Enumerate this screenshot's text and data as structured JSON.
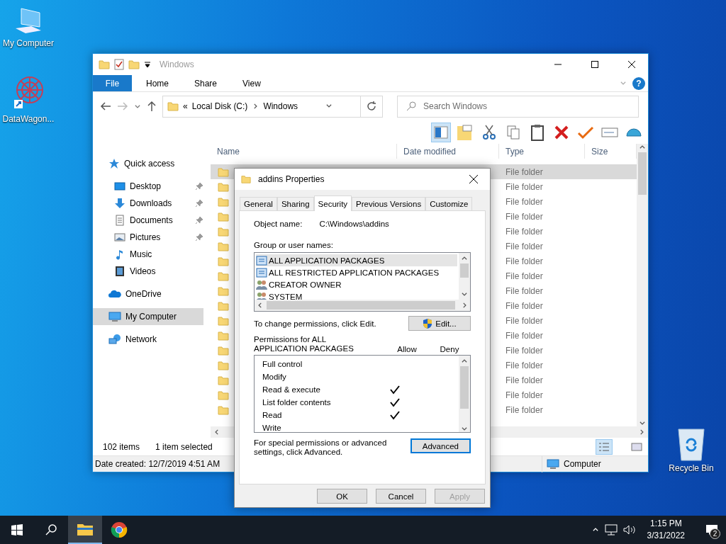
{
  "desktop_icons": [
    {
      "label": "My Computer",
      "kind": "computer"
    },
    {
      "label": "DataWagon...",
      "kind": "app"
    },
    {
      "label": "Recycle Bin",
      "kind": "recycle"
    }
  ],
  "explorer": {
    "title": "Windows",
    "file_tab": "File",
    "ribbon_tabs": [
      "Home",
      "Share",
      "View"
    ],
    "help": "?",
    "address": {
      "overflow": "«",
      "crumbs": [
        "Local Disk (C:)",
        "Windows"
      ]
    },
    "search": {
      "placeholder": "Search Windows"
    },
    "nav": [
      {
        "label": "Quick access",
        "kind": "star",
        "selected": false,
        "children": [
          {
            "label": "Desktop",
            "kind": "desktop",
            "pinned": true,
            "selected": false
          },
          {
            "label": "Downloads",
            "kind": "download",
            "pinned": true,
            "selected": false
          },
          {
            "label": "Documents",
            "kind": "document",
            "pinned": true,
            "selected": false
          },
          {
            "label": "Pictures",
            "kind": "pictures",
            "pinned": true,
            "selected": false
          },
          {
            "label": "Music",
            "kind": "music",
            "pinned": false,
            "selected": false
          },
          {
            "label": "Videos",
            "kind": "video",
            "pinned": false,
            "selected": false
          }
        ]
      },
      {
        "label": "OneDrive",
        "kind": "cloud",
        "selected": false
      },
      {
        "label": "My Computer",
        "kind": "computer",
        "selected": true
      },
      {
        "label": "Network",
        "kind": "network",
        "selected": false
      }
    ],
    "columns": [
      "Name",
      "Date modified",
      "Type",
      "Size"
    ],
    "rows": [
      {
        "type": "File folder",
        "selected": true
      },
      {
        "type": "File folder",
        "selected": false
      },
      {
        "type": "File folder",
        "selected": false
      },
      {
        "type": "File folder",
        "selected": false
      },
      {
        "type": "File folder",
        "selected": false
      },
      {
        "type": "File folder",
        "selected": false
      },
      {
        "type": "File folder",
        "selected": false
      },
      {
        "type": "File folder",
        "selected": false
      },
      {
        "type": "File folder",
        "selected": false
      },
      {
        "type": "File folder",
        "selected": false
      },
      {
        "type": "File folder",
        "selected": false
      },
      {
        "type": "File folder",
        "selected": false
      },
      {
        "type": "File folder",
        "selected": false
      },
      {
        "type": "File folder",
        "selected": false
      },
      {
        "type": "File folder",
        "selected": false
      },
      {
        "type": "File folder",
        "selected": false
      },
      {
        "type": "File folder",
        "selected": false
      }
    ],
    "status": {
      "count": "102 items",
      "selection": "1 item selected"
    },
    "details": {
      "created": "Date created: 12/7/2019 4:51 AM",
      "location": "Computer"
    }
  },
  "dialog": {
    "title": "addins Properties",
    "tabs": [
      {
        "label": "General",
        "selected": false
      },
      {
        "label": "Sharing",
        "selected": false
      },
      {
        "label": "Security",
        "selected": true
      },
      {
        "label": "Previous Versions",
        "selected": false
      },
      {
        "label": "Customize",
        "selected": false
      }
    ],
    "object_label": "Object name:",
    "object_value": "C:\\Windows\\addins",
    "groups_label": "Group or user names:",
    "groups": [
      {
        "name": "ALL APPLICATION PACKAGES",
        "kind": "package",
        "selected": true
      },
      {
        "name": "ALL RESTRICTED APPLICATION PACKAGES",
        "kind": "package",
        "selected": false
      },
      {
        "name": "CREATOR OWNER",
        "kind": "users",
        "selected": false
      },
      {
        "name": "SYSTEM",
        "kind": "users",
        "selected": false
      }
    ],
    "change_hint": "To change permissions, click Edit.",
    "edit_button": "Edit...",
    "permissions_label": "Permissions for ALL APPLICATION PACKAGES",
    "allow_label": "Allow",
    "deny_label": "Deny",
    "permissions": [
      {
        "name": "Full control",
        "allow": false,
        "deny": false
      },
      {
        "name": "Modify",
        "allow": false,
        "deny": false
      },
      {
        "name": "Read & execute",
        "allow": true,
        "deny": false
      },
      {
        "name": "List folder contents",
        "allow": true,
        "deny": false
      },
      {
        "name": "Read",
        "allow": true,
        "deny": false
      },
      {
        "name": "Write",
        "allow": false,
        "deny": false
      }
    ],
    "advanced_hint": "For special permissions or advanced settings, click Advanced.",
    "advanced_button": "Advanced",
    "buttons": [
      {
        "label": "OK",
        "disabled": false
      },
      {
        "label": "Cancel",
        "disabled": false
      },
      {
        "label": "Apply",
        "disabled": true
      }
    ]
  },
  "taskbar": {
    "time": "1:15 PM",
    "date": "3/31/2022",
    "notifications": "2"
  }
}
